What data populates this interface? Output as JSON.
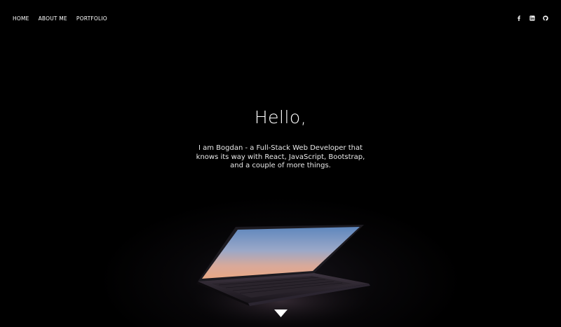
{
  "nav": {
    "items": [
      {
        "label": "HOME"
      },
      {
        "label": "ABOUT ME"
      },
      {
        "label": "PORTFOLIO"
      }
    ]
  },
  "social": {
    "items": [
      {
        "icon": "facebook-icon"
      },
      {
        "icon": "linkedin-icon"
      },
      {
        "icon": "github-icon"
      }
    ]
  },
  "hero": {
    "greeting": "Hello,",
    "intro": "I am Bogdan - a Full-Stack Web Developer that knows its way with React, JavaScript, Bootstrap, and a couple of more things.",
    "scroll_icon": "chevron-down-icon"
  },
  "colors": {
    "background": "#000000",
    "text": "#ffffff",
    "screen_glow_top": "#6f93c4",
    "screen_glow_bottom": "#e7a98a"
  }
}
